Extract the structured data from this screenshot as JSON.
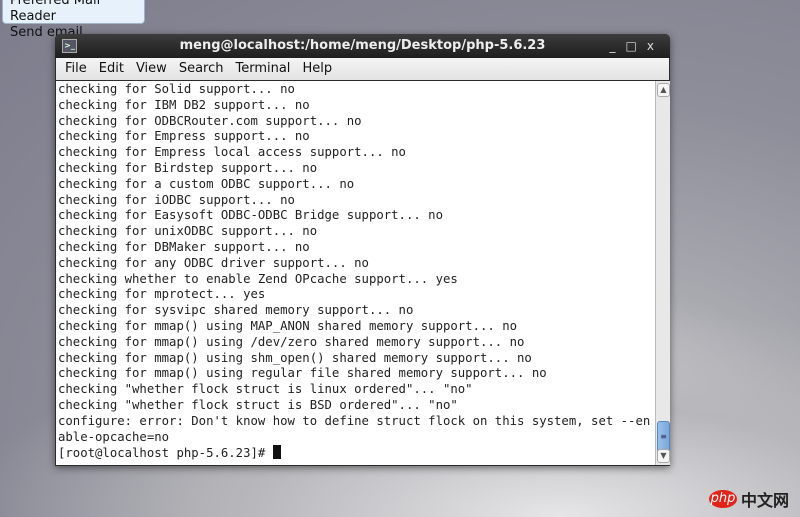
{
  "tooltip": {
    "items": [
      "Preferred Mail Reader",
      "Send email"
    ]
  },
  "window": {
    "title": "meng@localhost:/home/meng/Desktop/php-5.6.23",
    "controls": [
      "_",
      "□",
      "x"
    ]
  },
  "menu": [
    "File",
    "Edit",
    "View",
    "Search",
    "Terminal",
    "Help"
  ],
  "terminal": {
    "lines": [
      "checking for Solid support... no",
      "checking for IBM DB2 support... no",
      "checking for ODBCRouter.com support... no",
      "checking for Empress support... no",
      "checking for Empress local access support... no",
      "checking for Birdstep support... no",
      "checking for a custom ODBC support... no",
      "checking for iODBC support... no",
      "checking for Easysoft ODBC-ODBC Bridge support... no",
      "checking for unixODBC support... no",
      "checking for DBMaker support... no",
      "checking for any ODBC driver support... no",
      "checking whether to enable Zend OPcache support... yes",
      "checking for mprotect... yes",
      "checking for sysvipc shared memory support... no",
      "checking for mmap() using MAP_ANON shared memory support... no",
      "checking for mmap() using /dev/zero shared memory support... no",
      "checking for mmap() using shm_open() shared memory support... no",
      "checking for mmap() using regular file shared memory support... no",
      "checking \"whether flock struct is linux ordered\"... \"no\"",
      "checking \"whether flock struct is BSD ordered\"... \"no\"",
      "configure: error: Don't know how to define struct flock on this system, set --en",
      "able-opcache=no"
    ],
    "prompt": "[root@localhost php-5.6.23]# "
  },
  "watermark": {
    "badge": "php",
    "text": "中文网"
  }
}
